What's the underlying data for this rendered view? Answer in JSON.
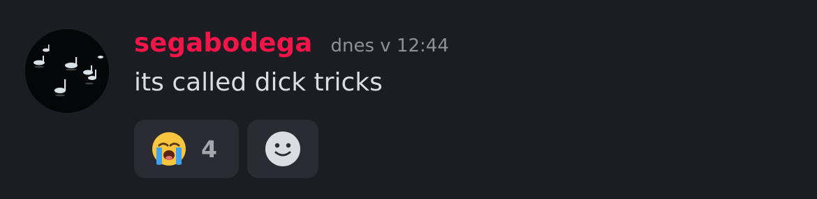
{
  "message": {
    "username": "segabodega",
    "username_color": "#f2154a",
    "timestamp": "dnes v 12:44",
    "content": "its called dick tricks",
    "avatar_icon": "swans-on-dark-water-avatar"
  },
  "reactions": [
    {
      "emoji_icon": "loudly-crying-face-icon",
      "count": "4"
    }
  ],
  "add_reaction": {
    "icon": "smiley-add-reaction-icon"
  },
  "colors": {
    "background": "#1c1d22",
    "reaction_background": "#2b2c33",
    "text": "#dcdde2",
    "muted": "#8e909a"
  }
}
